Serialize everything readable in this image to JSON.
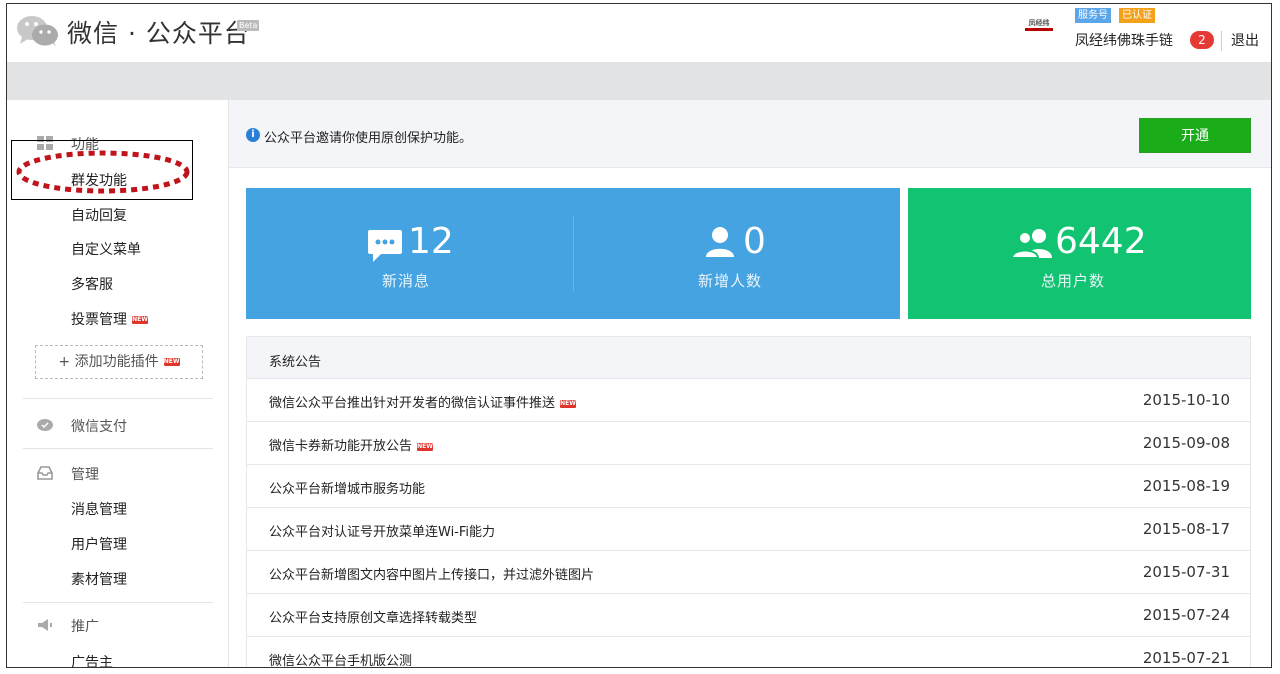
{
  "header": {
    "app_title": "微信 · 公众平台",
    "beta_label": "Beta",
    "account_logo_text": "凤经纬",
    "badge_service": "服务号",
    "badge_verified": "已认证",
    "account_name": "凤经纬佛珠手链",
    "notice_count": "2",
    "logout_label": "退出"
  },
  "sidebar": {
    "section_function": "功能",
    "function_items": [
      {
        "label": "群发功能"
      },
      {
        "label": "自动回复"
      },
      {
        "label": "自定义菜单"
      },
      {
        "label": "多客服"
      },
      {
        "label": "投票管理",
        "new": true
      }
    ],
    "add_plugin_label": "+ 添加功能插件",
    "new_tag": "NEW",
    "section_pay": "微信支付",
    "section_manage": "管理",
    "manage_items": [
      {
        "label": "消息管理"
      },
      {
        "label": "用户管理"
      },
      {
        "label": "素材管理"
      }
    ],
    "section_promote": "推广",
    "promote_items": [
      {
        "label": "广告主"
      }
    ]
  },
  "invite": {
    "text": "公众平台邀请你使用原创保护功能。",
    "button_label": "开通"
  },
  "stats": {
    "new_messages": {
      "value": "12",
      "label": "新消息"
    },
    "new_users": {
      "value": "0",
      "label": "新增人数"
    },
    "total_users": {
      "value": "6442",
      "label": "总用户数"
    }
  },
  "announcements": {
    "title": "系统公告",
    "items": [
      {
        "title": "微信公众平台推出针对开发者的微信认证事件推送",
        "date": "2015-10-10",
        "new": true
      },
      {
        "title": "微信卡券新功能开放公告",
        "date": "2015-09-08",
        "new": true
      },
      {
        "title": "公众平台新增城市服务功能",
        "date": "2015-08-19"
      },
      {
        "title": "公众平台对认证号开放菜单连Wi-Fi能力",
        "date": "2015-08-17"
      },
      {
        "title": "公众平台新增图文内容中图片上传接口，并过滤外链图片",
        "date": "2015-07-31"
      },
      {
        "title": "公众平台支持原创文章选择转载类型",
        "date": "2015-07-24"
      },
      {
        "title": "微信公众平台手机版公测",
        "date": "2015-07-21"
      }
    ]
  },
  "colors": {
    "stat_blue": "#44a3e0",
    "stat_green": "#12c371",
    "button_green": "#1aad19",
    "highlight_red": "#c0141c"
  }
}
